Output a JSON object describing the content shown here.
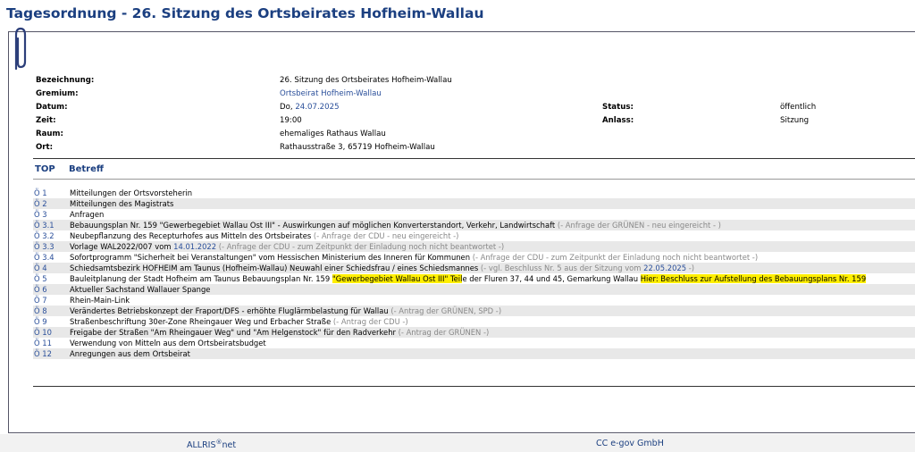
{
  "title": "Tagesordnung - 26. Sitzung des Ortsbeirates Hofheim-Wallau",
  "info": {
    "bezeichnung_label": "Bezeichnung:",
    "bezeichnung_value": "26. Sitzung des Ortsbeirates Hofheim-Wallau",
    "gremium_label": "Gremium:",
    "gremium_value": "Ortsbeirat Hofheim-Wallau",
    "datum_label": "Datum:",
    "datum_day": "Do, ",
    "datum_value": "24.07.2025",
    "zeit_label": "Zeit:",
    "zeit_value": "19:00",
    "raum_label": "Raum:",
    "raum_value": "ehemaliges Rathaus Wallau",
    "ort_label": "Ort:",
    "ort_value": "Rathausstraße 3, 65719 Hofheim-Wallau",
    "status_label": "Status:",
    "status_value": "öffentlich",
    "anlass_label": "Anlass:",
    "anlass_value": "Sitzung"
  },
  "table": {
    "col_top": "TOP",
    "col_betreff": "Betreff",
    "rows": [
      {
        "top": "Ö 1",
        "text": "Mitteilungen der Ortsvorsteherin"
      },
      {
        "top": "Ö 2",
        "text": "Mitteilungen des Magistrats"
      },
      {
        "top": "Ö 3",
        "text": "Anfragen"
      },
      {
        "top": "Ö 3.1",
        "text": "Bebauungsplan Nr. 159 \"Gewerbegebiet Wallau Ost III\" - Auswirkungen auf möglichen Konverterstandort, Verkehr, Landwirtschaft",
        "note": " (- Anfrage der GRÜNEN - neu eingereicht - )"
      },
      {
        "top": "Ö 3.2",
        "text": "Neubepflanzung des Recepturhofes aus Mitteln des Ortsbeirates",
        "note": " (- Anfrage der CDU - neu eingereicht -)"
      },
      {
        "top": "Ö 3.3",
        "text": "Vorlage WAL2022/007 vom ",
        "link": "14.01.2022",
        "note": " (- Anfrage der CDU - zum Zeitpunkt der Einladung noch nicht beantwortet -)"
      },
      {
        "top": "Ö 3.4",
        "text": "Sofortprogramm \"Sicherheit bei Veranstaltungen\" vom Hessischen Ministerium des Inneren für Kommunen",
        "note": " (- Anfrage der CDU - zum Zeitpunkt der Einladung noch nicht beantwortet -)"
      },
      {
        "top": "Ö 4",
        "text": "Schiedsamtsbezirk HOFHEIM am Taunus (Hofheim-Wallau) Neuwahl einer Schiedsfrau / eines Schiedsmannes",
        "note": " (- vgl. Beschluss Nr. 5 aus der Sitzung vom ",
        "link2": "22.05.2025",
        "note2": " -)"
      },
      {
        "top": "Ö 5",
        "text": "Bauleitplanung der Stadt Hofheim am Taunus Bebauungsplan Nr. 159 ",
        "hl1": "\"Gewerbegebiet Wallau Ost III\" Teil",
        "text2": "e der Fluren 37, 44 und 45, Gemarkung Wallau ",
        "hl2": "Hier: Beschluss zur Aufstellung des Bebauungsplans Nr. 159"
      },
      {
        "top": "Ö 6",
        "text": "Aktueller Sachstand Wallauer Spange"
      },
      {
        "top": "Ö 7",
        "text": "Rhein-Main-Link"
      },
      {
        "top": "Ö 8",
        "text": "Verändertes Betriebskonzept der Fraport/DFS - erhöhte Fluglärmbelastung für Wallau",
        "note": " (- Antrag der GRÜNEN, SPD -)"
      },
      {
        "top": "Ö 9",
        "text": "Straßenbeschriftung 30er-Zone Rheingauer Weg und Erbacher Straße",
        "note": " (- Antrag der CDU -)"
      },
      {
        "top": "Ö 10",
        "text": "Freigabe der Straßen \"Am Rheingauer Weg\" und \"Am Helgenstock\" für den Radverkehr",
        "note": " (- Antrag der GRÜNEN -)"
      },
      {
        "top": "Ö 11",
        "text": "Verwendung von Mitteln aus dem Ortsbeiratsbudget"
      },
      {
        "top": "Ö 12",
        "text": "Anregungen aus dem Ortsbeirat"
      }
    ]
  },
  "footer": {
    "left": "ALLRIS",
    "left_sup": "®",
    "left_suffix": "net",
    "right": "CC e-gov GmbH"
  },
  "colors": {
    "title": "#1b3f80",
    "link": "#2a4f9a",
    "highlight": "#ffef00"
  },
  "icons": {
    "clip": "paperclip-icon"
  }
}
